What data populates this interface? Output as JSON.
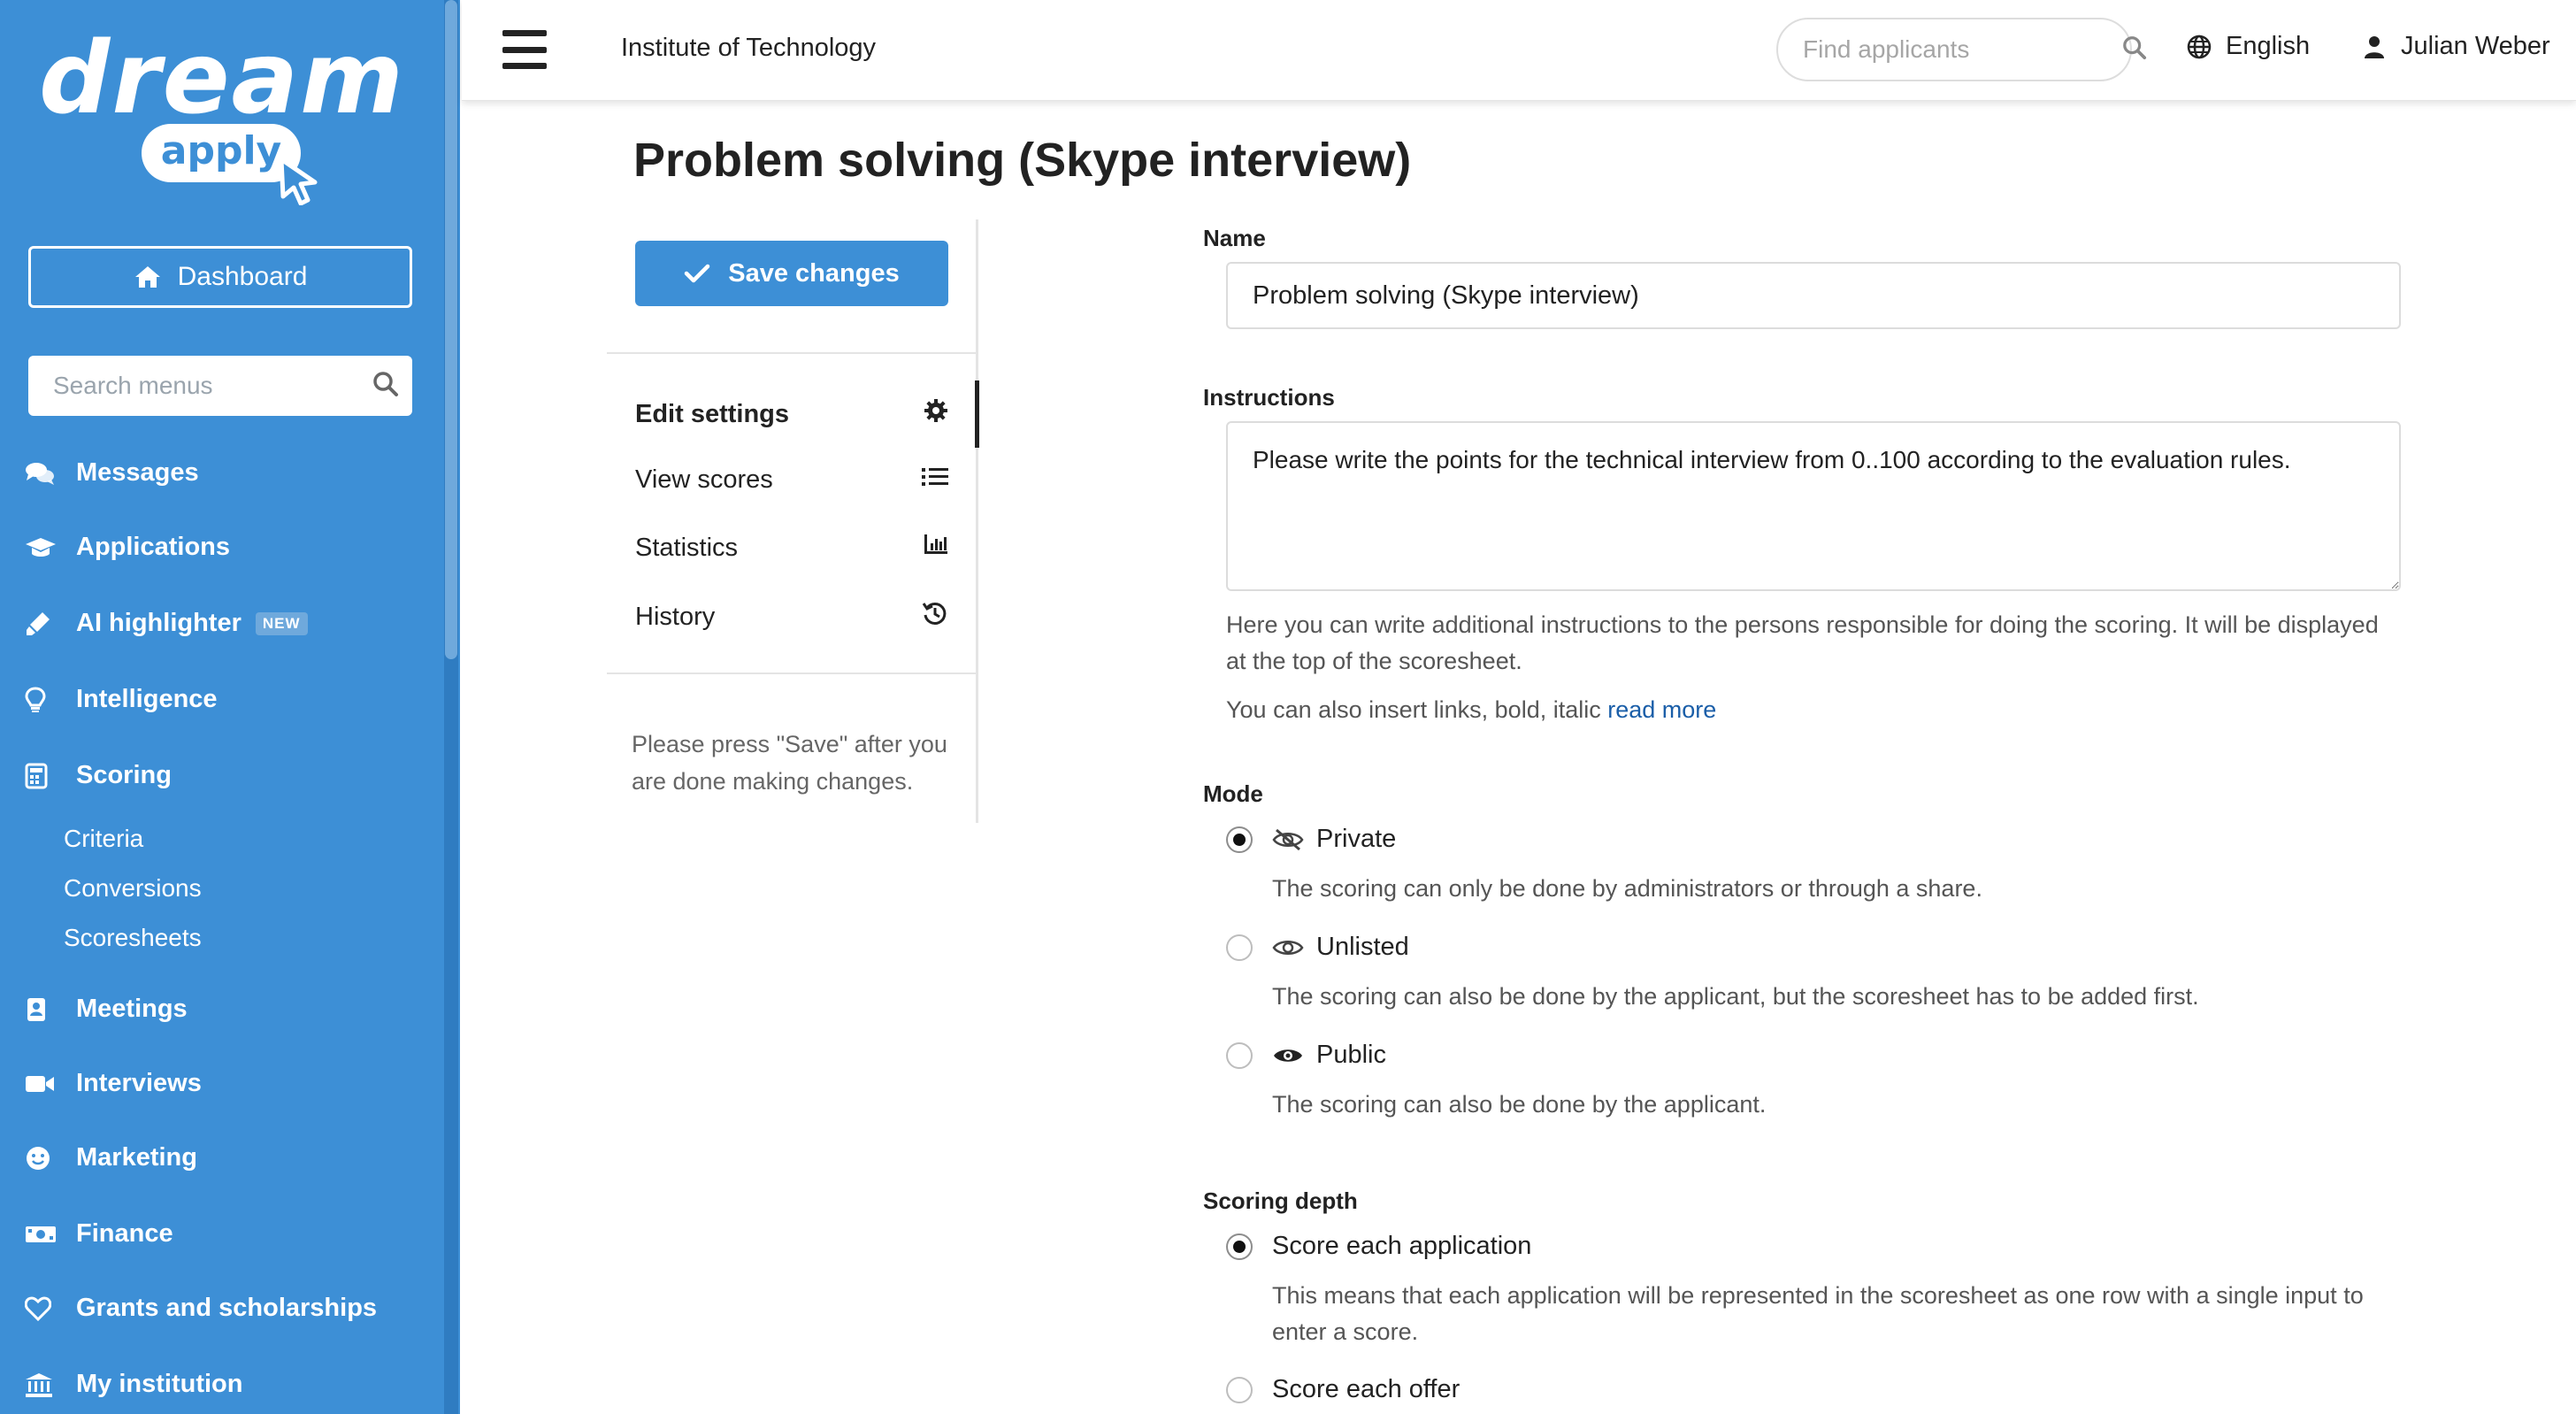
{
  "brand": {
    "logo_top": "dream",
    "logo_bottom": "apply"
  },
  "sidebar": {
    "dashboard_label": "Dashboard",
    "search_placeholder": "Search menus",
    "items": [
      {
        "label": "Messages",
        "icon": "comments-icon"
      },
      {
        "label": "Applications",
        "icon": "graduation-cap-icon"
      },
      {
        "label": "AI highlighter",
        "icon": "highlighter-icon",
        "badge": "NEW"
      },
      {
        "label": "Intelligence",
        "icon": "lightbulb-icon"
      },
      {
        "label": "Scoring",
        "icon": "calculator-icon"
      },
      {
        "label": "Meetings",
        "icon": "address-book-icon"
      },
      {
        "label": "Interviews",
        "icon": "video-icon"
      },
      {
        "label": "Marketing",
        "icon": "smile-icon"
      },
      {
        "label": "Finance",
        "icon": "money-icon"
      },
      {
        "label": "Grants and scholarships",
        "icon": "heart-icon"
      },
      {
        "label": "My institution",
        "icon": "institution-icon"
      }
    ],
    "scoring_sub": [
      "Criteria",
      "Conversions",
      "Scoresheets"
    ]
  },
  "topbar": {
    "org_name": "Institute of Technology",
    "find_placeholder": "Find applicants",
    "language": "English",
    "user_name": "Julian Weber"
  },
  "page": {
    "title": "Problem solving (Skype interview)",
    "save_label": "Save changes",
    "submenu": [
      {
        "label": "Edit settings",
        "icon": "gear-icon",
        "active": true
      },
      {
        "label": "View scores",
        "icon": "list-icon",
        "active": false
      },
      {
        "label": "Statistics",
        "icon": "bar-chart-icon",
        "active": false
      },
      {
        "label": "History",
        "icon": "history-icon",
        "active": false
      }
    ],
    "note": "Please press \"Save\" after you are done making changes."
  },
  "form": {
    "name_label": "Name",
    "name_value": "Problem solving (Skype interview)",
    "instructions_label": "Instructions",
    "instructions_value": "Please write the points for the technical interview from 0..100 according to the evaluation rules.",
    "instructions_help": "Here you can write additional instructions to the persons responsible for doing the scoring. It will be displayed at the top of the scoresheet.",
    "instructions_help2": "You can also insert links, bold, italic",
    "read_more": "read more",
    "mode_label": "Mode",
    "mode_options": [
      {
        "label": "Private",
        "desc": "The scoring can only be done by administrators or through a share.",
        "checked": true,
        "icon": "eye-slash-icon"
      },
      {
        "label": "Unlisted",
        "desc": "The scoring can also be done by the applicant, but the scoresheet has to be added first.",
        "checked": false,
        "icon": "eye-outline-icon"
      },
      {
        "label": "Public",
        "desc": "The scoring can also be done by the applicant.",
        "checked": false,
        "icon": "eye-icon"
      }
    ],
    "depth_label": "Scoring depth",
    "depth_options": [
      {
        "label": "Score each application",
        "desc": "This means that each application will be represented in the scoresheet as one row with a single input to enter a score.",
        "checked": true
      },
      {
        "label": "Score each offer",
        "checked": false
      }
    ]
  }
}
